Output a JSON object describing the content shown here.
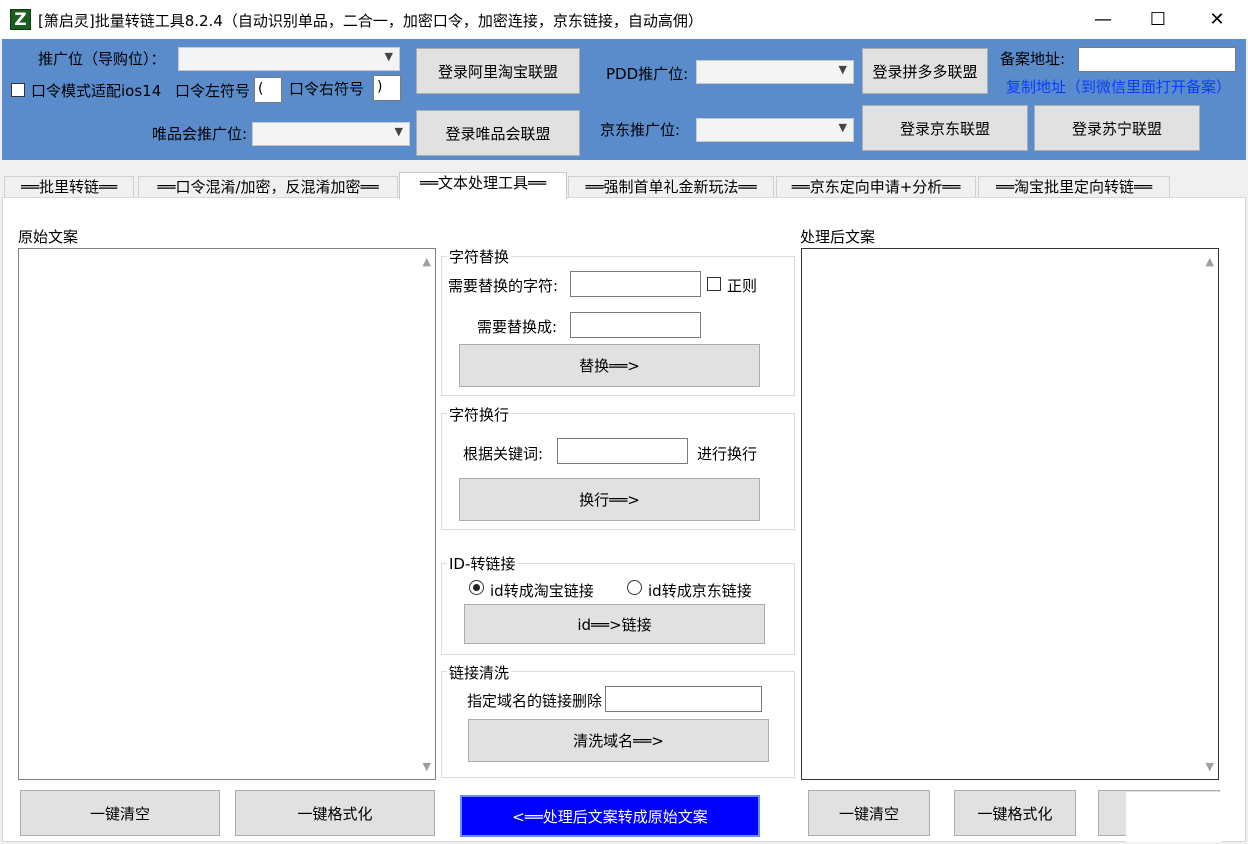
{
  "window": {
    "title": "[箫启灵]批量转链工具8.2.4（自动识别单品，二合一，加密口令，加密连接，京东链接，自动高佣）",
    "icon_letter": "Z",
    "minimize_glyph": "—",
    "maximize_glyph": "☐",
    "close_glyph": "✕"
  },
  "header": {
    "promo_label": "推广位（导购位）：",
    "ios14_label": "口令模式适配ios14",
    "left_symbol_label": "口令左符号",
    "left_symbol_value": "(",
    "right_symbol_label": "口令右符号",
    "right_symbol_value": ")",
    "vip_label": "唯品会推广位:",
    "login_ali": "登录阿里淘宝联盟",
    "login_vip": "登录唯品会联盟",
    "pdd_label": "PDD推广位:",
    "jd_label": "京东推广位:",
    "login_pdd": "登录拼多多联盟",
    "login_jd": "登录京东联盟",
    "login_suning": "登录苏宁联盟",
    "beian_label": "备案地址:",
    "copy_link": "复制地址（到微信里面打开备案）"
  },
  "tabs": [
    {
      "label": "══批里转链══"
    },
    {
      "label": "══口令混淆/加密，反混淆加密══"
    },
    {
      "label": "══文本处理工具══"
    },
    {
      "label": "══强制首单礼金新玩法══"
    },
    {
      "label": "══京东定向申请+分析══"
    },
    {
      "label": "══淘宝批里定向转链══"
    }
  ],
  "panel": {
    "original_label": "原始文案",
    "processed_label": "处理后文案",
    "replace_group": {
      "title": "字符替换",
      "find_label": "需要替换的字符:",
      "regex_label": "正则",
      "replace_label": "需要替换成:",
      "button": "替换══>"
    },
    "newline_group": {
      "title": "字符换行",
      "keyword_label": "根据关键词:",
      "suffix_label": "进行换行",
      "button": "换行══>"
    },
    "id_group": {
      "title": "ID-转链接",
      "radio_taobao": "id转成淘宝链接",
      "radio_jd": "id转成京东链接",
      "button": "id══>链接"
    },
    "clean_group": {
      "title": "链接清洗",
      "domain_label": "指定域名的链接删除",
      "button": "清洗域名══>"
    },
    "left_clear": "一键清空",
    "left_format": "一键格式化",
    "convert_back": "<══处理后文案转成原始文案",
    "right_clear": "一键清空",
    "right_format": "一键格式化"
  },
  "colors": {
    "header_bg": "#5a8ccc",
    "link_blue": "#0a3cff",
    "convert_button_bg": "#0000ff"
  }
}
